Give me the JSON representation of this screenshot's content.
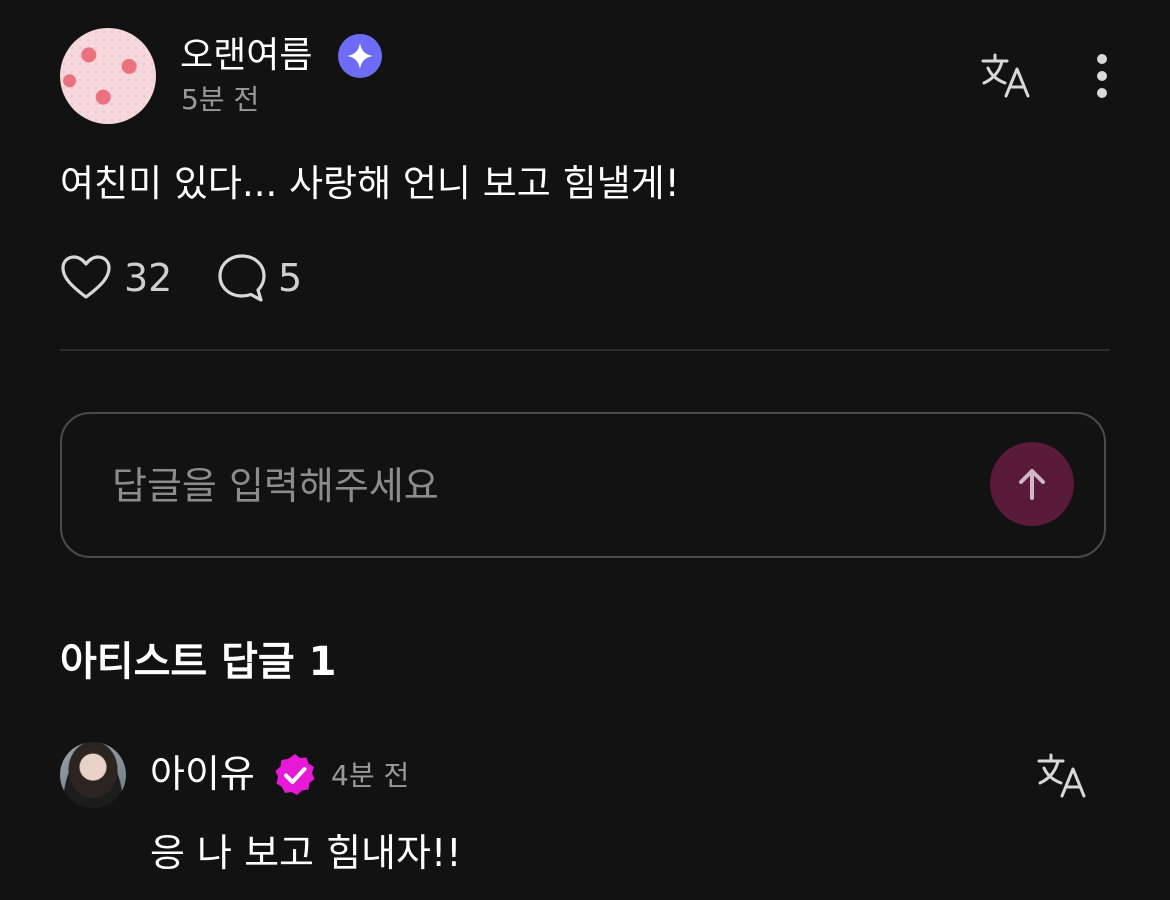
{
  "post": {
    "author": "오랜여름",
    "author_badge_icon": "sparkle-icon",
    "time": "5분 전",
    "body": "여친미 있다... 사랑해 언니 보고 힘낼게!",
    "likes": "32",
    "comments": "5"
  },
  "reply_input": {
    "placeholder": "답글을 입력해주세요",
    "value": ""
  },
  "artist_replies": {
    "title": "아티스트 답글 1",
    "items": [
      {
        "name": "아이유",
        "badge_icon": "verified-icon",
        "time": "4분 전",
        "text": "응 나 보고 힘내자!!"
      }
    ]
  },
  "colors": {
    "background": "#121212",
    "sparkle_badge": "#6e6cf5",
    "verified_badge": "#e619d6",
    "send_button": "#5a1a3c"
  }
}
